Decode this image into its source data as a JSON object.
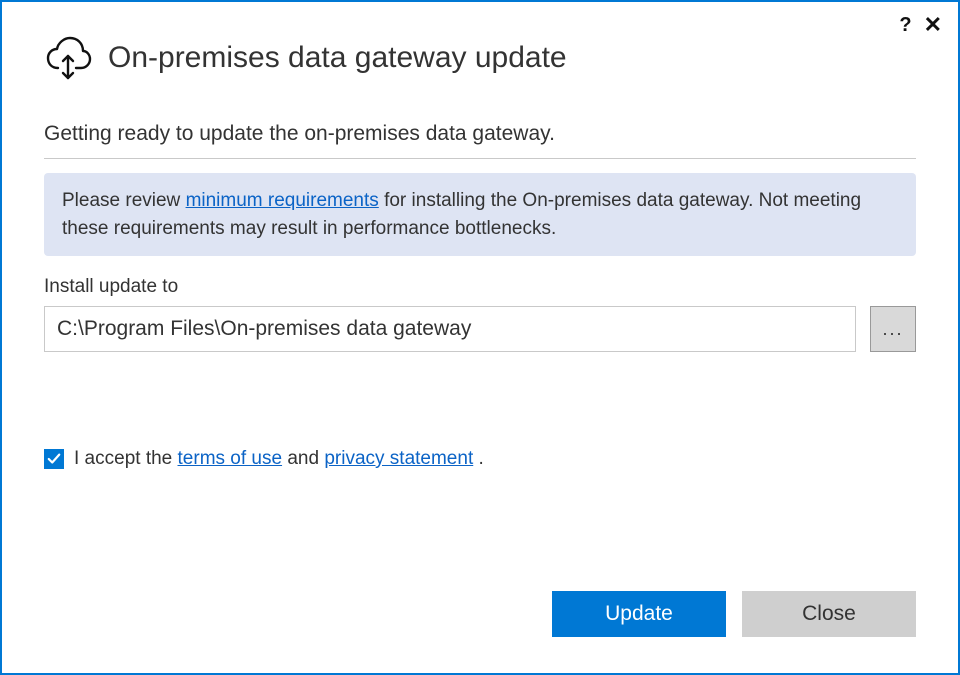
{
  "header": {
    "title": "On-premises data gateway update"
  },
  "subtitle": "Getting ready to update the on-premises data gateway.",
  "info": {
    "prefix": "Please review ",
    "link_text": "minimum requirements",
    "suffix": " for installing the On-premises data gateway. Not meeting these requirements may result in performance bottlenecks."
  },
  "install": {
    "label": "Install update to",
    "path": "C:\\Program Files\\On-premises data gateway",
    "browse_label": "..."
  },
  "accept": {
    "checked": true,
    "prefix": "I accept the ",
    "terms_link": "terms of use",
    "middle": " and ",
    "privacy_link": "privacy statement",
    "suffix": " ."
  },
  "buttons": {
    "primary": "Update",
    "secondary": "Close"
  },
  "titlebar": {
    "help": "?",
    "close": "✕"
  }
}
